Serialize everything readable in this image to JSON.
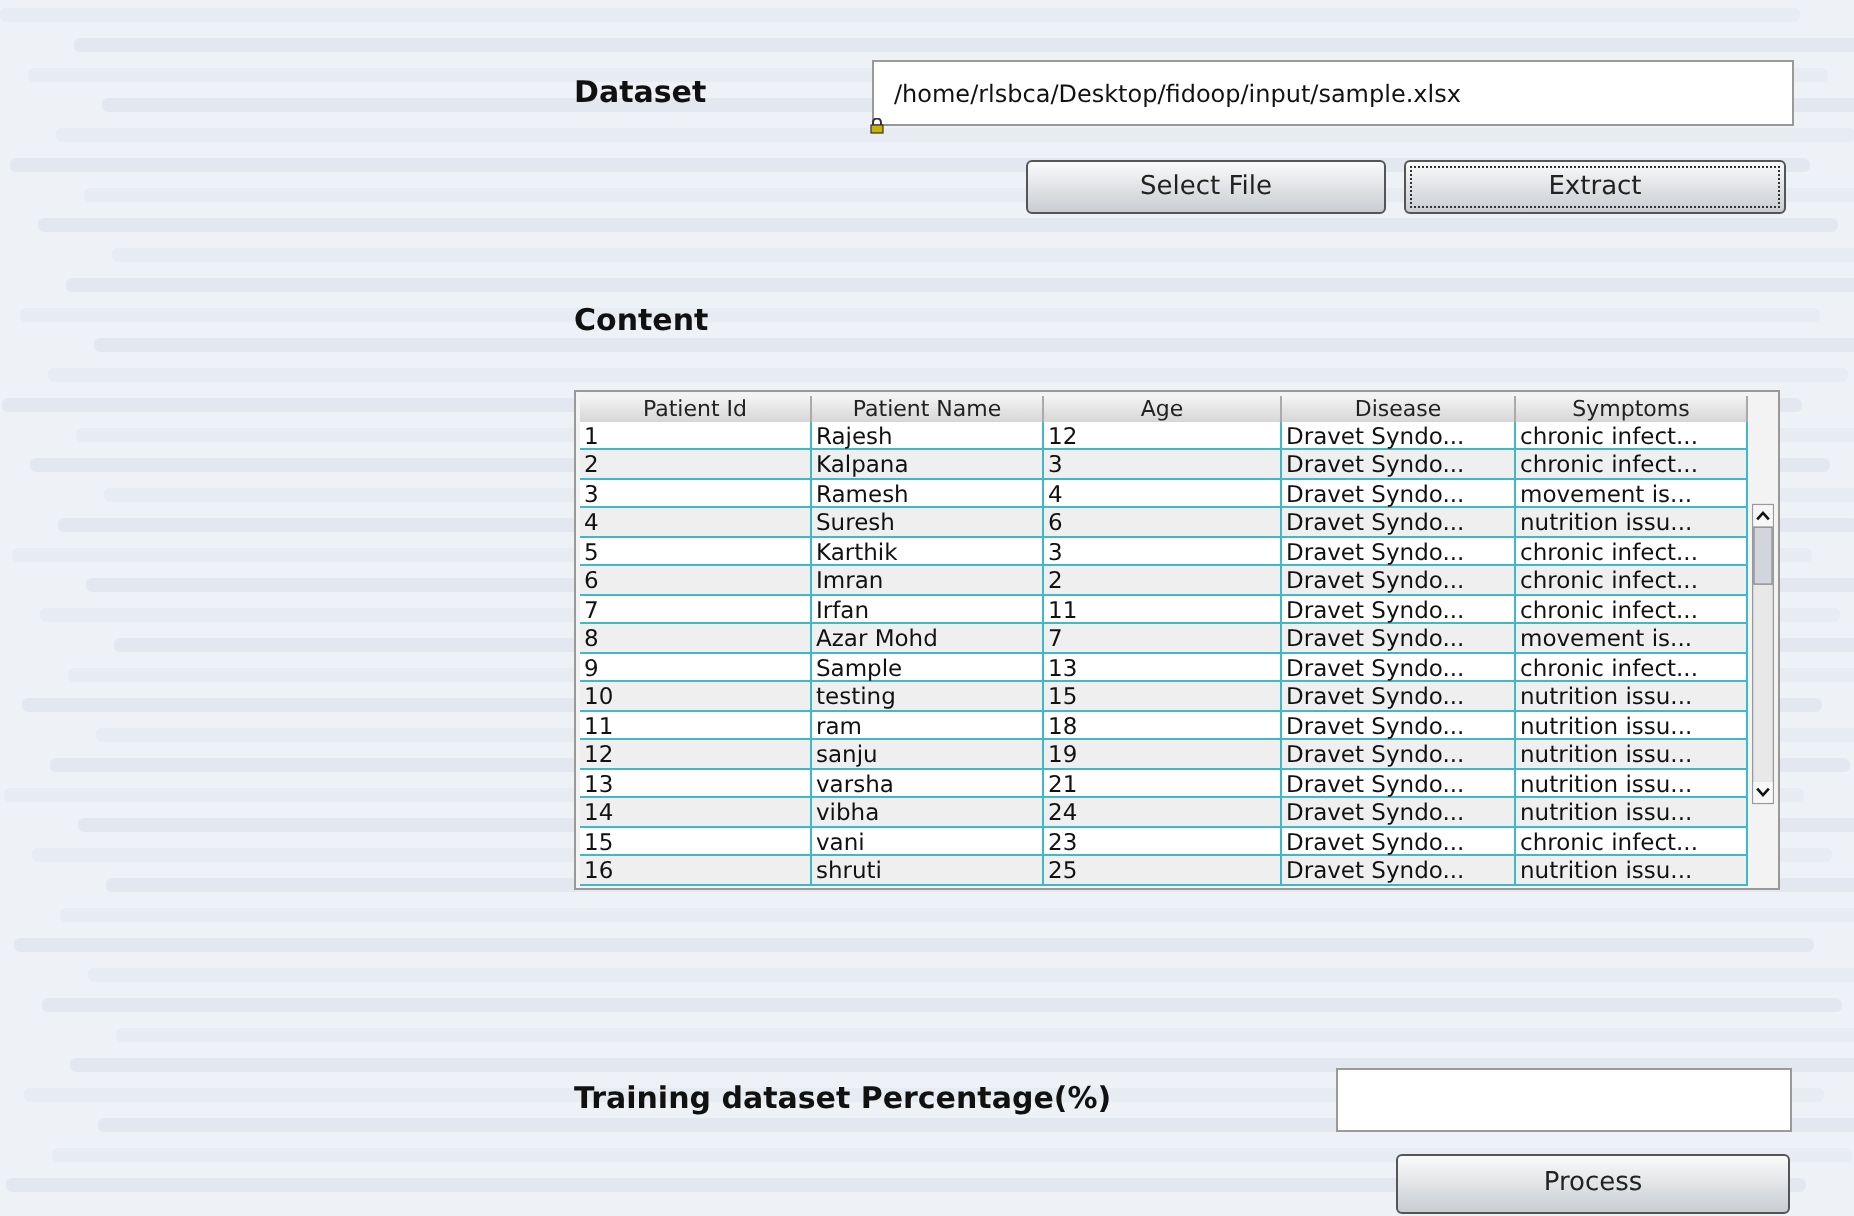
{
  "dataset": {
    "label": "Dataset",
    "value": "/home/rlsbca/Desktop/fidoop/input/sample.xlsx"
  },
  "buttons": [
    {
      "label": "Select File",
      "focused": false
    },
    {
      "label": "Extract",
      "focused": true
    }
  ],
  "content": {
    "label": "Content"
  },
  "table": {
    "columns": [
      "Patient Id",
      "Patient Name",
      "Age",
      "Disease",
      "Symptoms"
    ],
    "rows": [
      [
        "1",
        "Rajesh",
        "12",
        "Dravet Syndo...",
        "chronic infect..."
      ],
      [
        "2",
        "Kalpana",
        "3",
        "Dravet Syndo...",
        "chronic infect..."
      ],
      [
        "3",
        "Ramesh",
        "4",
        "Dravet Syndo...",
        "movement is..."
      ],
      [
        "4",
        "Suresh",
        "6",
        "Dravet Syndo...",
        "nutrition issu..."
      ],
      [
        "5",
        "Karthik",
        "3",
        "Dravet Syndo...",
        "chronic infect..."
      ],
      [
        "6",
        "Imran",
        "2",
        "Dravet Syndo...",
        "chronic infect..."
      ],
      [
        "7",
        "Irfan",
        "11",
        "Dravet Syndo...",
        "chronic infect..."
      ],
      [
        "8",
        "Azar Mohd",
        "7",
        "Dravet Syndo...",
        "movement is..."
      ],
      [
        "9",
        "Sample",
        "13",
        "Dravet Syndo...",
        "chronic infect..."
      ],
      [
        "10",
        "testing",
        "15",
        "Dravet Syndo...",
        "nutrition issu..."
      ],
      [
        "11",
        "ram",
        "18",
        "Dravet Syndo...",
        "nutrition issu..."
      ],
      [
        "12",
        "sanju",
        "19",
        "Dravet Syndo...",
        "nutrition issu..."
      ],
      [
        "13",
        "varsha",
        "21",
        "Dravet Syndo...",
        "nutrition issu..."
      ],
      [
        "14",
        "vibha",
        "24",
        "Dravet Syndo...",
        "nutrition issu..."
      ],
      [
        "15",
        "vani",
        "23",
        "Dravet Syndo...",
        "chronic infect..."
      ],
      [
        "16",
        "shruti",
        "25",
        "Dravet Syndo...",
        "nutrition issu..."
      ]
    ]
  },
  "training": {
    "label": "Training dataset Percentage(%)"
  },
  "process_button": {
    "label": "Process"
  }
}
